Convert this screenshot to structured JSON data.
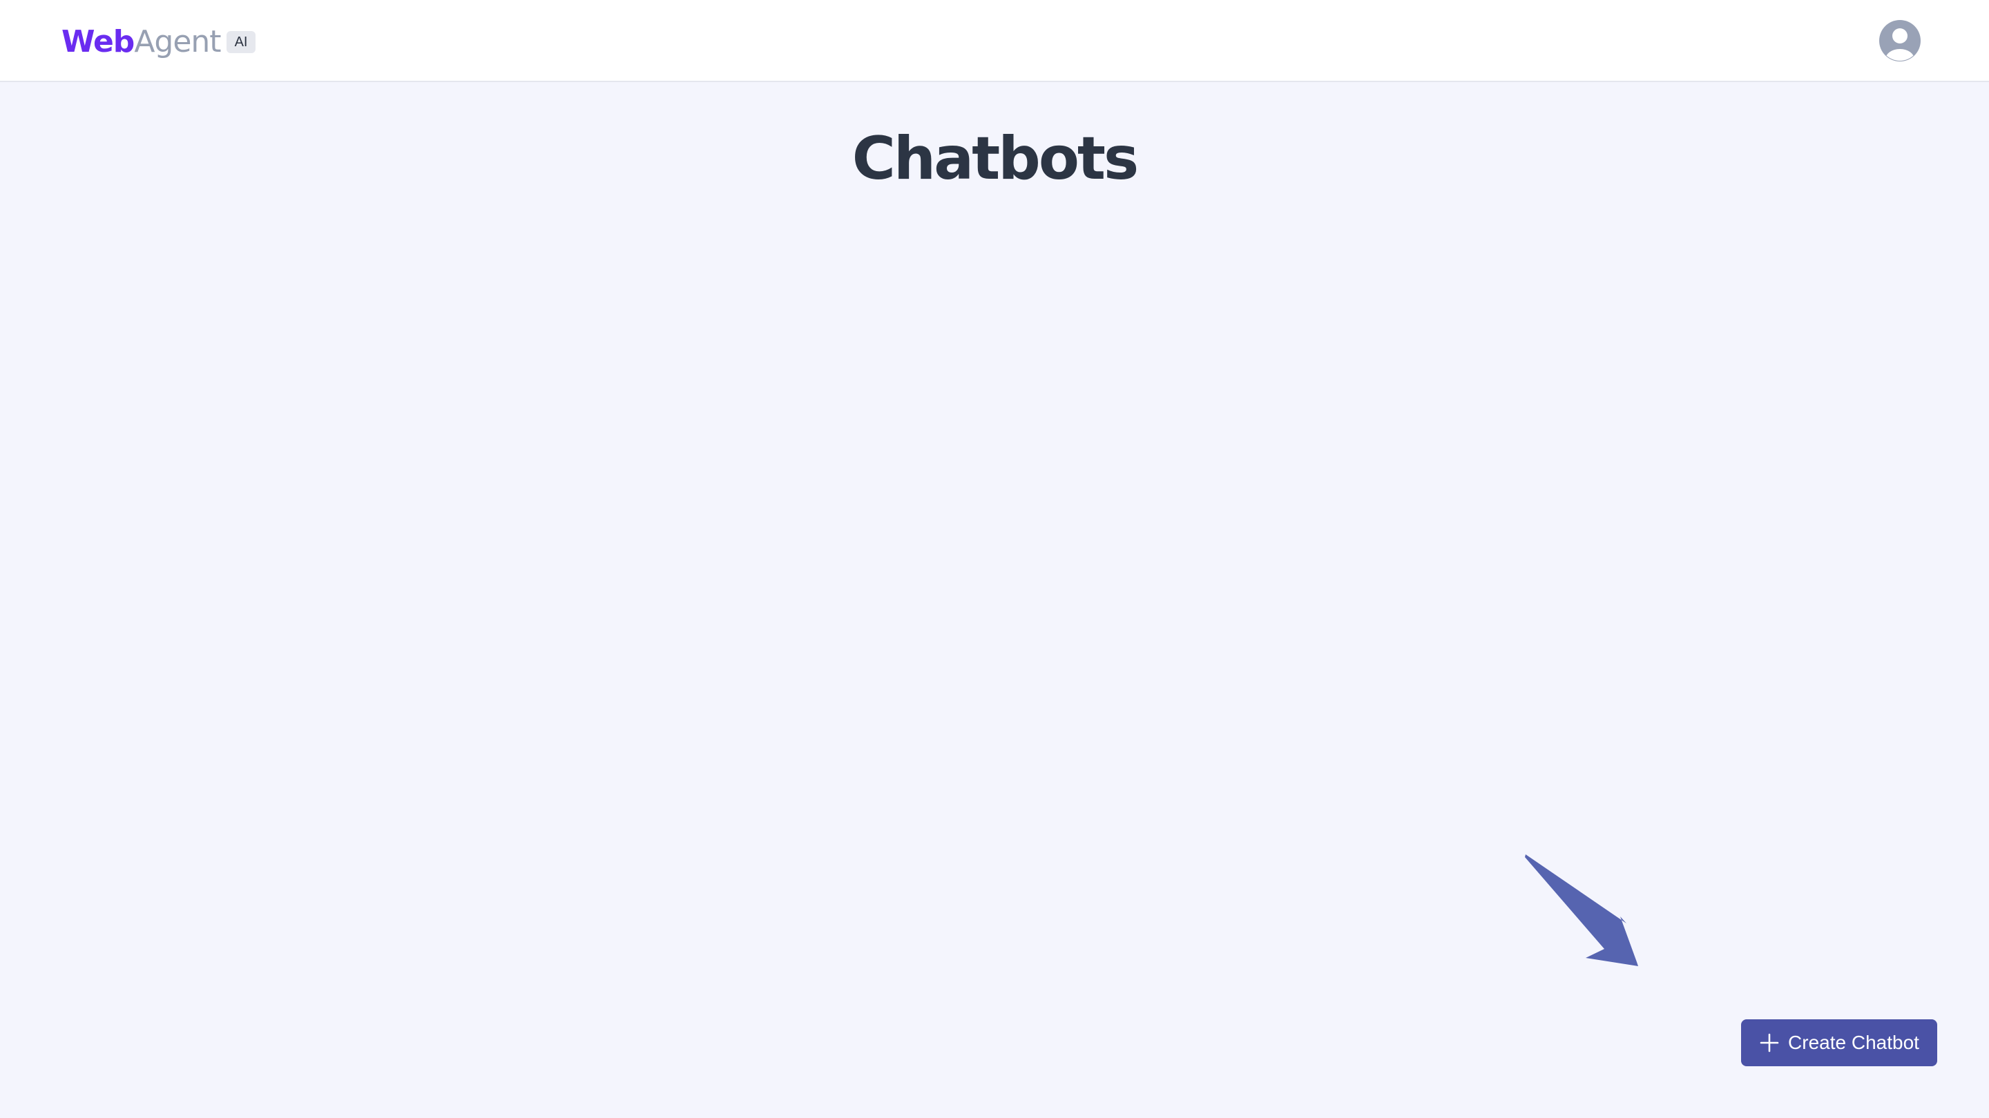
{
  "header": {
    "logo_primary": "Web",
    "logo_secondary": "Agent",
    "logo_badge": "AI",
    "avatar_icon": "user-avatar-icon"
  },
  "main": {
    "title": "Chatbots",
    "create_button": {
      "label": "Create Chatbot",
      "icon": "plus-icon"
    }
  },
  "annotation": {
    "arrow_icon": "arrow-pointer-icon",
    "arrow_color": "#5664b0"
  },
  "colors": {
    "brand_purple": "#6a2cf0",
    "brand_gray": "#97a0b2",
    "button_bg": "#4a52a6",
    "page_bg": "#f4f5fd",
    "title_color": "#2c3544"
  }
}
